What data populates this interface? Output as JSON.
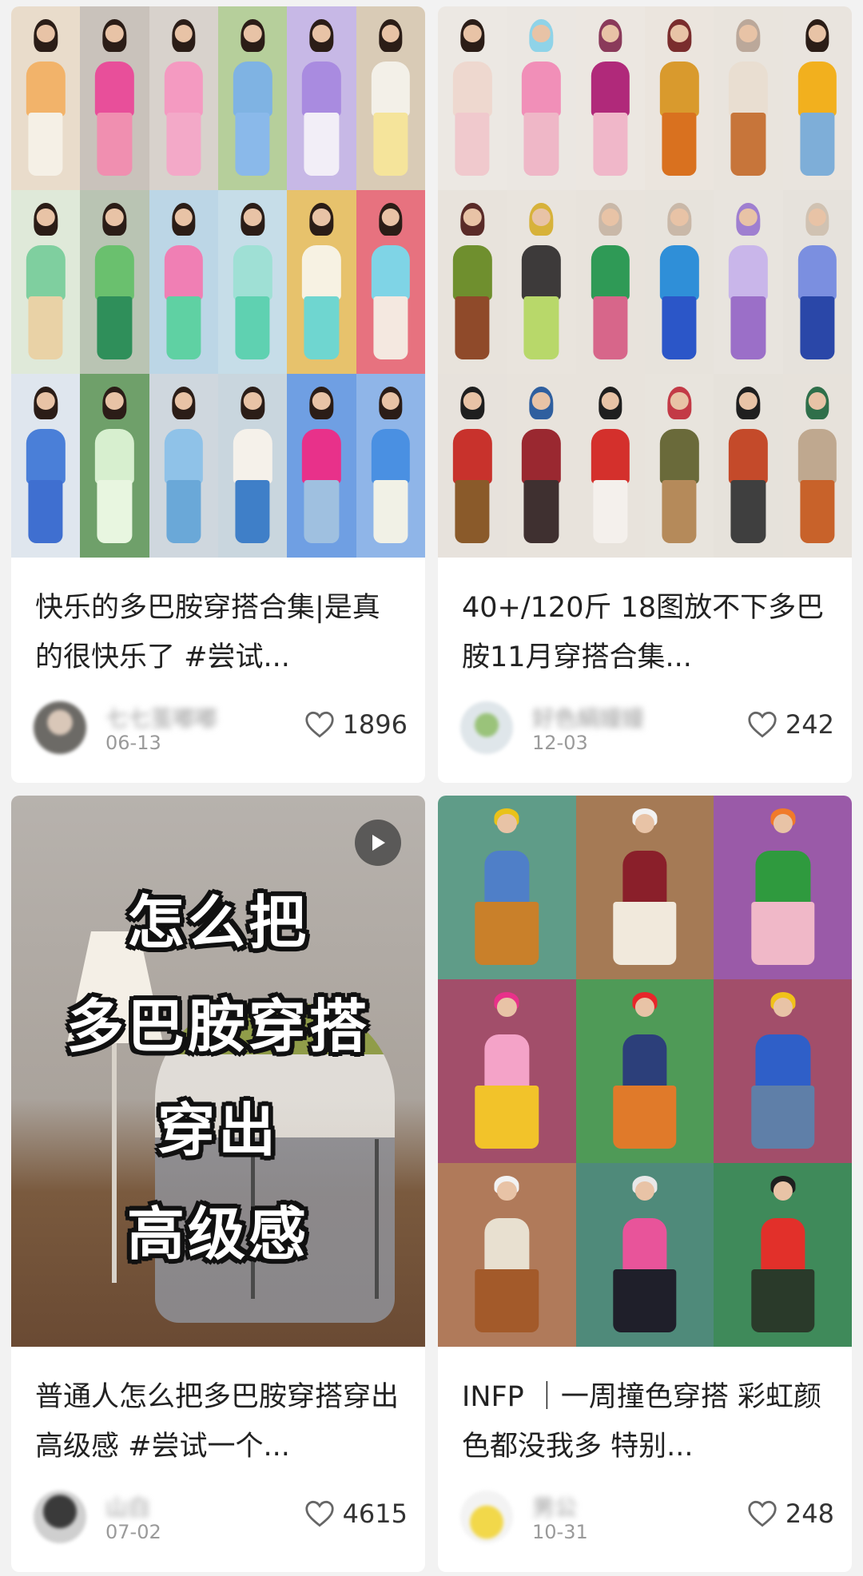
{
  "colors": {
    "page_bg": "#f2f2f2",
    "card_bg": "#ffffff",
    "text": "#222222",
    "meta_text": "#9a9a9a",
    "heart": "#666666"
  },
  "posts": [
    {
      "title": "快乐的多巴胺穿搭合集|是真的很快乐了 #尝试...",
      "username": "七七茧嘟嘟",
      "date": "06-13",
      "likes": "1896",
      "is_video": false
    },
    {
      "title": "40+/120斤 18图放不下多巴胺11月穿搭合集...",
      "username": "好色絹嫚嫚",
      "date": "12-03",
      "likes": "242",
      "is_video": false
    },
    {
      "title": "普通人怎么把多巴胺穿搭穿出高级感 #尝试一个...",
      "username": "山白",
      "date": "07-02",
      "likes": "4615",
      "is_video": true,
      "overlay_lines": [
        "怎么把",
        "多巴胺穿搭",
        "穿出",
        "高级感"
      ]
    },
    {
      "title": "INFP ｜一周撞色穿搭 彩虹颜色都没我多 特别...",
      "username": "男公",
      "date": "10-31",
      "likes": "248",
      "is_video": false
    }
  ]
}
